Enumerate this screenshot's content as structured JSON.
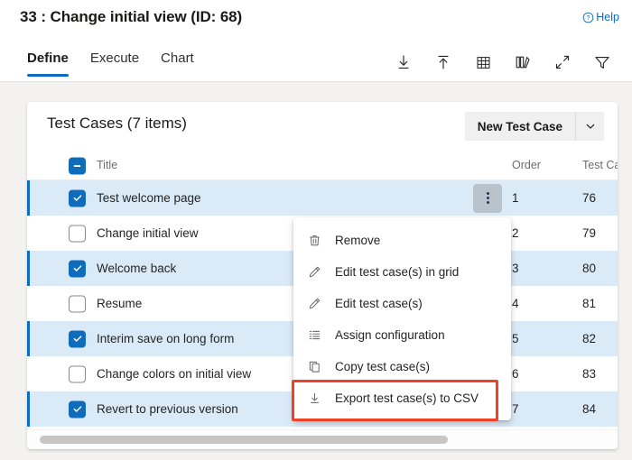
{
  "header": {
    "title": "33 : Change initial view (ID: 68)",
    "help_label": "Help",
    "help_icon": "question-circle-icon"
  },
  "tabs": [
    {
      "label": "Define",
      "active": true
    },
    {
      "label": "Execute",
      "active": false
    },
    {
      "label": "Chart",
      "active": false
    }
  ],
  "toolbar": [
    {
      "name": "download-icon",
      "title": "Download"
    },
    {
      "name": "upload-icon",
      "title": "Upload"
    },
    {
      "name": "grid-icon",
      "title": "Grid"
    },
    {
      "name": "columns-edit-icon",
      "title": "Column options"
    },
    {
      "name": "expand-icon",
      "title": "Full screen"
    },
    {
      "name": "filter-icon",
      "title": "Filter"
    }
  ],
  "card": {
    "title": "Test Cases (7 items)",
    "new_button_label": "New Test Case",
    "new_button_chevron": "chevron-down-icon"
  },
  "grid": {
    "columns": [
      {
        "key": "title",
        "label": "Title"
      },
      {
        "key": "order",
        "label": "Order"
      },
      {
        "key": "testcase",
        "label": "Test Ca"
      }
    ],
    "header_checkbox_state": "indeterminate",
    "rows": [
      {
        "checked": true,
        "title": "Test welcome page",
        "order": "1",
        "testcase": "76"
      },
      {
        "checked": false,
        "title": "Change initial view",
        "order": "2",
        "testcase": "79"
      },
      {
        "checked": true,
        "title": "Welcome back",
        "order": "3",
        "testcase": "80"
      },
      {
        "checked": false,
        "title": "Resume",
        "order": "4",
        "testcase": "81"
      },
      {
        "checked": true,
        "title": "Interim save on long form",
        "order": "5",
        "testcase": "82"
      },
      {
        "checked": false,
        "title": "Change colors on initial view",
        "order": "6",
        "testcase": "83"
      },
      {
        "checked": true,
        "title": "Revert to previous version",
        "order": "7",
        "testcase": "84"
      }
    ]
  },
  "context_menu": {
    "open_on_row": 0,
    "items": [
      {
        "label": "Remove",
        "icon": "trash-icon",
        "highlighted": false
      },
      {
        "label": "Edit test case(s) in grid",
        "icon": "pencil-icon",
        "highlighted": false
      },
      {
        "label": "Edit test case(s)",
        "icon": "pencil-icon",
        "highlighted": false
      },
      {
        "label": "Assign configuration",
        "icon": "list-icon",
        "highlighted": false
      },
      {
        "label": "Copy test case(s)",
        "icon": "copy-icon",
        "highlighted": false
      },
      {
        "label": "Export test case(s) to CSV",
        "icon": "download-icon",
        "highlighted": true
      }
    ]
  },
  "colors": {
    "accent": "#0f6cbd",
    "selected_row": "#dbeaf7",
    "highlight_box": "#ef4123",
    "page_background": "#f3f2f1"
  }
}
